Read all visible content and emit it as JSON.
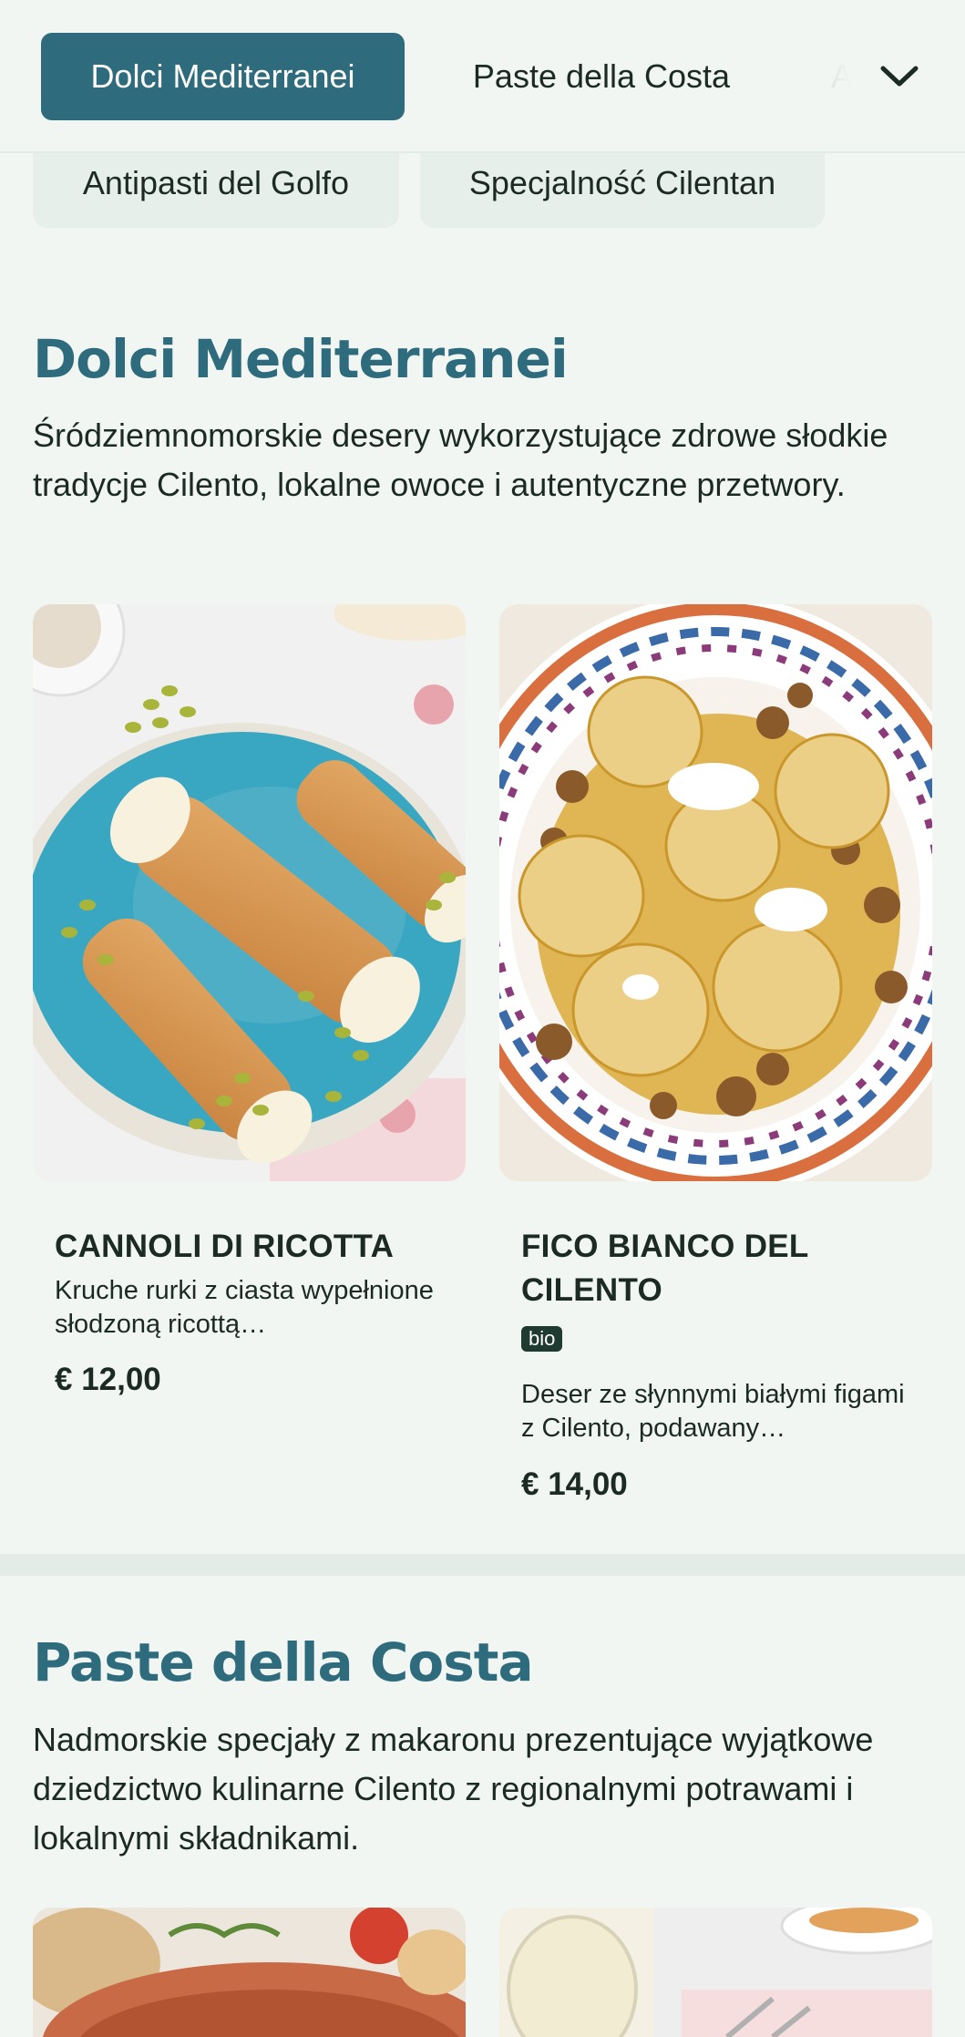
{
  "nav": {
    "tabs": [
      {
        "label": "Dolci Mediterranei",
        "active": true
      },
      {
        "label": "Paste della Costa",
        "active": false
      },
      {
        "label": "A",
        "active": false
      }
    ],
    "expand_icon": "chevron-down-icon"
  },
  "chips": [
    {
      "label": "Antipasti del Golfo"
    },
    {
      "label": "Specjalność Cilentan"
    }
  ],
  "sections": [
    {
      "title": "Dolci Mediterranei",
      "description": "Śródziemnomorskie desery wykorzystujące zdrowe słodkie tradycje Cilento, lokalne owoce i autentyczne przetwory.",
      "items": [
        {
          "name": "CANNOLI DI RICOTTA",
          "description": "Kruche rurki z ciasta wypełnione słodzoną ricottą…",
          "price": "€ 12,00",
          "badge": null
        },
        {
          "name": "FICO BIANCO DEL CILENTO",
          "description": "Deser ze słynnymi białymi figami z Cilento, podawany…",
          "price": "€ 14,00",
          "badge": "bio"
        }
      ]
    },
    {
      "title": "Paste della Costa",
      "description": "Nadmorskie specjały z makaronu prezentujące wyjątkowe dziedzictwo kulinarne Cilento z regionalnymi potrawami i lokalnymi składnikami."
    }
  ],
  "colors": {
    "accent": "#2e6b7d",
    "background": "#f2f6f3",
    "text": "#1c2a24"
  }
}
